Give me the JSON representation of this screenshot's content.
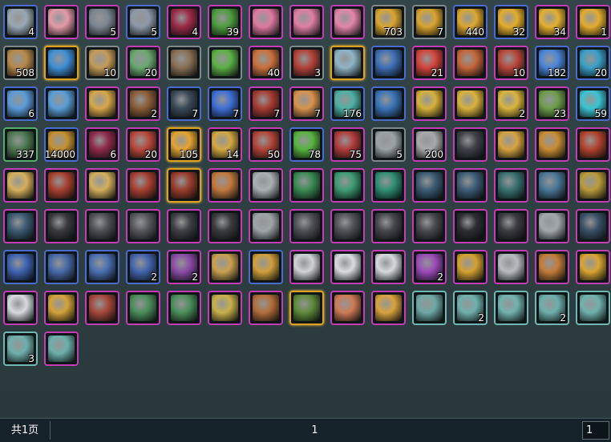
{
  "footer": {
    "total_pages_label": "共1页",
    "current_page": "1",
    "page_input_value": "1"
  },
  "inventory": {
    "rows": [
      [
        {
          "icon": "feather-crescent-icon",
          "qty": "4",
          "color": "#9aa8b3",
          "frame": "blue"
        },
        {
          "icon": "pink-cloth-icon",
          "qty": "",
          "color": "#e49aa8",
          "frame": "pink"
        },
        {
          "icon": "armor-plate-icon",
          "qty": "5",
          "color": "#7c8690",
          "frame": "pink"
        },
        {
          "icon": "treasure-chest-icon",
          "qty": "5",
          "color": "#8e98a8",
          "frame": "blue"
        },
        {
          "icon": "red-gem-icon",
          "qty": "4",
          "color": "#9b2b46",
          "frame": "pink"
        },
        {
          "icon": "bamboo-leaves-icon",
          "qty": "39",
          "color": "#4d9c3e",
          "frame": "pink"
        },
        {
          "icon": "peach-blossom-icon",
          "qty": "",
          "color": "#df7aa0",
          "frame": "pink"
        },
        {
          "icon": "peach-blossom-icon",
          "qty": "",
          "color": "#e07fa4",
          "frame": "pink"
        },
        {
          "icon": "peach-blossom-icon",
          "qty": "",
          "color": "#e586aa",
          "frame": "pink"
        },
        {
          "icon": "gold-nuggets-icon",
          "qty": "703",
          "color": "#d9a531",
          "frame": "gray"
        },
        {
          "icon": "gold-nuggets-icon",
          "qty": "7",
          "color": "#d9a42f",
          "frame": "gray"
        },
        {
          "icon": "gold-nuggets-icon",
          "qty": "440",
          "color": "#dba730",
          "frame": "blue"
        },
        {
          "icon": "gold-block-icon",
          "qty": "32",
          "color": "#e3ad2c",
          "frame": "blue"
        },
        {
          "icon": "gold-block-icon",
          "qty": "34",
          "color": "#e4b030",
          "frame": "pink"
        },
        {
          "icon": "gold-block-icon",
          "qty": "1",
          "color": "#e3ac2e",
          "frame": "pink"
        }
      ],
      [
        {
          "icon": "scroll-icon",
          "qty": "508",
          "color": "#b8894a",
          "frame": "gray"
        },
        {
          "icon": "blue-crystal-card-icon",
          "qty": "",
          "color": "#3f8fd6",
          "frame": "gold"
        },
        {
          "icon": "scroll-icon",
          "qty": "10",
          "color": "#c49b59",
          "frame": "gray"
        },
        {
          "icon": "jade-ornament-icon",
          "qty": "20",
          "color": "#6aa870",
          "frame": "pink"
        },
        {
          "icon": "map-fragment-icon",
          "qty": "",
          "color": "#8a6f55",
          "frame": "gray"
        },
        {
          "icon": "sprout-icon",
          "qty": "",
          "color": "#5eb047",
          "frame": "gray"
        },
        {
          "icon": "roast-meal-icon",
          "qty": "40",
          "color": "#c9703c",
          "frame": "pink"
        },
        {
          "icon": "red-cloak-icon",
          "qty": "3",
          "color": "#b2433a",
          "frame": "gray"
        },
        {
          "icon": "silver-ore-icon",
          "qty": "",
          "color": "#8fb4c4",
          "frame": "gold"
        },
        {
          "icon": "blue-fabric-icon",
          "qty": "",
          "color": "#3f6fb6",
          "frame": "blue"
        },
        {
          "icon": "red-orb-icon",
          "qty": "21",
          "color": "#d4443c",
          "frame": "pink"
        },
        {
          "icon": "ornate-box-icon",
          "qty": "",
          "color": "#c5663a",
          "frame": "pink"
        },
        {
          "icon": "red-letter-icon",
          "qty": "10",
          "color": "#b9473b",
          "frame": "pink"
        },
        {
          "icon": "blue-potion-icon",
          "qty": "182",
          "color": "#4b86d8",
          "frame": "blue"
        },
        {
          "icon": "blue-orbs-icon",
          "qty": "20",
          "color": "#3a9fc7",
          "frame": "blue"
        }
      ],
      [
        {
          "icon": "blue-pouch-icon",
          "qty": "6",
          "color": "#5a9bd8",
          "frame": "blue"
        },
        {
          "icon": "blue-pouch-icon",
          "qty": "",
          "color": "#5b9dd5",
          "frame": "blue"
        },
        {
          "icon": "golden-flowers-icon",
          "qty": "",
          "color": "#d7a64a",
          "frame": "pink"
        },
        {
          "icon": "leather-book-icon",
          "qty": "2",
          "color": "#8a5b36",
          "frame": "pink"
        },
        {
          "icon": "dark-powder-bowl-icon",
          "qty": "7",
          "color": "#3b4957",
          "frame": "blue"
        },
        {
          "icon": "blue-pearls-bowl-icon",
          "qty": "7",
          "color": "#3f6fd6",
          "frame": "blue"
        },
        {
          "icon": "red-soup-icon",
          "qty": "7",
          "color": "#a63b32",
          "frame": "pink"
        },
        {
          "icon": "bun-dish-icon",
          "qty": "7",
          "color": "#d8934e",
          "frame": "pink"
        },
        {
          "icon": "teal-crystal-icon",
          "qty": "176",
          "color": "#4fb0a4",
          "frame": "blue"
        },
        {
          "icon": "blue-cloth-icon",
          "qty": "",
          "color": "#3b74b8",
          "frame": "blue"
        },
        {
          "icon": "gold-crystal-icon",
          "qty": "",
          "color": "#d8b03a",
          "frame": "pink"
        },
        {
          "icon": "gold-crystal-icon",
          "qty": "",
          "color": "#d9b23c",
          "frame": "pink"
        },
        {
          "icon": "gold-crystal-icon",
          "qty": "2",
          "color": "#dab43e",
          "frame": "pink"
        },
        {
          "icon": "green-stone-icon",
          "qty": "23",
          "color": "#6e9c4a",
          "frame": "pink"
        },
        {
          "icon": "cyan-swirl-icon",
          "qty": "59",
          "color": "#3cc4d2",
          "frame": "blue"
        }
      ],
      [
        {
          "icon": "green-mask-icon",
          "qty": "337",
          "color": "#4e7a52",
          "frame": "green"
        },
        {
          "icon": "gold-staff-icon",
          "qty": "14000",
          "color": "#c49032",
          "frame": "blue"
        },
        {
          "icon": "red-gem-icon",
          "qty": "6",
          "color": "#8e2a4a",
          "frame": "pink"
        },
        {
          "icon": "red-chest-icon",
          "qty": "20",
          "color": "#b8473b",
          "frame": "pink"
        },
        {
          "icon": "gold-figure-icon",
          "qty": "105",
          "color": "#e3a431",
          "frame": "gold"
        },
        {
          "icon": "gold-book-icon",
          "qty": "14",
          "color": "#d2a843",
          "frame": "pink"
        },
        {
          "icon": "red-chest-icon",
          "qty": "50",
          "color": "#b34538",
          "frame": "pink"
        },
        {
          "icon": "green-orb-icon",
          "qty": "78",
          "color": "#58b33f",
          "frame": "blue"
        },
        {
          "icon": "red-blade-icon",
          "qty": "75",
          "color": "#b33c3c",
          "frame": "pink"
        },
        {
          "icon": "yin-yang-icon",
          "qty": "5",
          "color": "#9aa3a6",
          "frame": "gray"
        },
        {
          "icon": "silver-ingot-icon",
          "qty": "200",
          "color": "#a7a9ab",
          "frame": "pink"
        },
        {
          "icon": "black-necklace-icon",
          "qty": "",
          "color": "#3f4248",
          "frame": "pink"
        },
        {
          "icon": "golden-dagger-icon",
          "qty": "",
          "color": "#d7a341",
          "frame": "pink"
        },
        {
          "icon": "golden-sword-icon",
          "qty": "",
          "color": "#c98c34",
          "frame": "pink"
        },
        {
          "icon": "red-horn-icon",
          "qty": "",
          "color": "#b4432f",
          "frame": "pink"
        }
      ],
      [
        {
          "icon": "golden-dagger-icon",
          "qty": "",
          "color": "#d6b05c",
          "frame": "pink"
        },
        {
          "icon": "red-crossbow-icon",
          "qty": "",
          "color": "#a8402f",
          "frame": "pink"
        },
        {
          "icon": "golden-dagger-icon",
          "qty": "",
          "color": "#d3ae5d",
          "frame": "pink"
        },
        {
          "icon": "red-crossbow-icon",
          "qty": "",
          "color": "#a73f31",
          "frame": "pink"
        },
        {
          "icon": "dark-scepter-icon",
          "qty": "",
          "color": "#9a3c2d",
          "frame": "gold"
        },
        {
          "icon": "amber-bracer-icon",
          "qty": "",
          "color": "#c2783e",
          "frame": "pink"
        },
        {
          "icon": "silver-horn-icon",
          "qty": "",
          "color": "#a9b0b4",
          "frame": "pink"
        },
        {
          "icon": "green-boots-icon",
          "qty": "",
          "color": "#3c8a55",
          "frame": "pink"
        },
        {
          "icon": "jade-necklace-icon",
          "qty": "",
          "color": "#3e9b74",
          "frame": "pink"
        },
        {
          "icon": "green-gloves-icon",
          "qty": "",
          "color": "#2f8f73",
          "frame": "pink"
        },
        {
          "icon": "dark-vest-icon",
          "qty": "",
          "color": "#3b5b74",
          "frame": "pink"
        },
        {
          "icon": "dark-vest-icon",
          "qty": "",
          "color": "#3d5d76",
          "frame": "pink"
        },
        {
          "icon": "teal-leggings-icon",
          "qty": "",
          "color": "#3a7071",
          "frame": "pink"
        },
        {
          "icon": "blue-robe-icon",
          "qty": "",
          "color": "#4a7695",
          "frame": "pink"
        },
        {
          "icon": "golden-chain-icon",
          "qty": "",
          "color": "#b99a3b",
          "frame": "pink"
        }
      ],
      [
        {
          "icon": "dark-helmet-icon",
          "qty": "",
          "color": "#3c5a73",
          "frame": "pink"
        },
        {
          "icon": "dark-bow-icon",
          "qty": "",
          "color": "#3a3a3e",
          "frame": "pink"
        },
        {
          "icon": "dark-greaves-icon",
          "qty": "",
          "color": "#4d4f54",
          "frame": "pink"
        },
        {
          "icon": "dark-gauntlet-icon",
          "qty": "",
          "color": "#55575c",
          "frame": "pink"
        },
        {
          "icon": "dark-greaves-icon",
          "qty": "",
          "color": "#3d3f44",
          "frame": "pink"
        },
        {
          "icon": "dark-bow-icon",
          "qty": "",
          "color": "#3a3b3f",
          "frame": "pink"
        },
        {
          "icon": "silver-armor-icon",
          "qty": "",
          "color": "#9fa4a8",
          "frame": "pink"
        },
        {
          "icon": "dark-gauntlet-icon",
          "qty": "",
          "color": "#4e5055",
          "frame": "pink"
        },
        {
          "icon": "dark-gauntlet-icon",
          "qty": "",
          "color": "#505257",
          "frame": "pink"
        },
        {
          "icon": "dark-trousers-icon",
          "qty": "",
          "color": "#45474c",
          "frame": "pink"
        },
        {
          "icon": "dark-trousers-icon",
          "qty": "",
          "color": "#47494e",
          "frame": "pink"
        },
        {
          "icon": "black-belt-icon",
          "qty": "",
          "color": "#2c2e31",
          "frame": "pink"
        },
        {
          "icon": "dark-bow-icon",
          "qty": "",
          "color": "#3b3c40",
          "frame": "pink"
        },
        {
          "icon": "silver-armor-icon",
          "qty": "",
          "color": "#a3a8ac",
          "frame": "pink"
        },
        {
          "icon": "dark-shoulder-icon",
          "qty": "",
          "color": "#3a4f66",
          "frame": "pink"
        }
      ],
      [
        {
          "icon": "blue-sash-icon",
          "qty": "",
          "color": "#3d63b1",
          "frame": "blue"
        },
        {
          "icon": "blue-boots-icon",
          "qty": "",
          "color": "#4869a8",
          "frame": "blue"
        },
        {
          "icon": "blue-robe-icon",
          "qty": "",
          "color": "#4a6fb2",
          "frame": "blue"
        },
        {
          "icon": "blue-bag-icon",
          "qty": "2",
          "color": "#4364ad",
          "frame": "blue"
        },
        {
          "icon": "purple-bag-icon",
          "qty": "2",
          "color": "#8a4ca6",
          "frame": "pink"
        },
        {
          "icon": "gold-pouch-icon",
          "qty": "",
          "color": "#c9a050",
          "frame": "pink"
        },
        {
          "icon": "golden-sword-icon",
          "qty": "",
          "color": "#d0a03c",
          "frame": "blue"
        },
        {
          "icon": "silver-pendant-icon",
          "qty": "",
          "color": "#cfd3d6",
          "frame": "pink"
        },
        {
          "icon": "white-robe-icon",
          "qty": "",
          "color": "#d9dde0",
          "frame": "pink"
        },
        {
          "icon": "white-skirt-icon",
          "qty": "",
          "color": "#d6dadd",
          "frame": "pink"
        },
        {
          "icon": "purple-ring-icon",
          "qty": "2",
          "color": "#9b4bb8",
          "frame": "pink"
        },
        {
          "icon": "gold-ring-icon",
          "qty": "",
          "color": "#d5a132",
          "frame": "pink"
        },
        {
          "icon": "silver-pendant-icon",
          "qty": "",
          "color": "#b8bcc0",
          "frame": "pink"
        },
        {
          "icon": "golden-amulet-icon",
          "qty": "",
          "color": "#c37c3a",
          "frame": "pink"
        },
        {
          "icon": "gold-ring-icon",
          "qty": "",
          "color": "#d9a433",
          "frame": "pink"
        }
      ],
      [
        {
          "icon": "silver-ring-icon",
          "qty": "",
          "color": "#d7dade",
          "frame": "pink"
        },
        {
          "icon": "gold-ring-icon",
          "qty": "",
          "color": "#d3a23a",
          "frame": "pink"
        },
        {
          "icon": "red-brooch-icon",
          "qty": "",
          "color": "#a7473a",
          "frame": "pink"
        },
        {
          "icon": "green-necklace-icon",
          "qty": "",
          "color": "#4b8d5a",
          "frame": "pink"
        },
        {
          "icon": "green-necklace-icon",
          "qty": "",
          "color": "#4c8e5b",
          "frame": "pink"
        },
        {
          "icon": "fleur-amulet-icon",
          "qty": "",
          "color": "#c8b04b",
          "frame": "pink"
        },
        {
          "icon": "bronze-ring-icon",
          "qty": "",
          "color": "#b36d3a",
          "frame": "pink"
        },
        {
          "icon": "green-sash-icon",
          "qty": "",
          "color": "#5f8a3b",
          "frame": "gold"
        },
        {
          "icon": "coral-fan-icon",
          "qty": "",
          "color": "#cf7a55",
          "frame": "pink"
        },
        {
          "icon": "gold-medal-icon",
          "qty": "",
          "color": "#d9a23e",
          "frame": "pink"
        },
        {
          "icon": "tile-pattern-icon",
          "qty": "",
          "color": "#6ea8a4",
          "frame": "teal"
        },
        {
          "icon": "banner-icon",
          "qty": "2",
          "color": "#6fb0ac",
          "frame": "teal"
        },
        {
          "icon": "screen-panel-icon",
          "qty": "",
          "color": "#72b2ae",
          "frame": "teal"
        },
        {
          "icon": "banner-icon",
          "qty": "2",
          "color": "#6eafab",
          "frame": "teal"
        },
        {
          "icon": "banner-icon",
          "qty": "",
          "color": "#70b1ad",
          "frame": "teal"
        }
      ],
      [
        {
          "icon": "lamp-icon",
          "qty": "3",
          "color": "#6fb0ac",
          "frame": "teal"
        },
        {
          "icon": "bird-emblem-icon",
          "qty": "",
          "color": "#6dafab",
          "frame": "pink"
        }
      ]
    ]
  }
}
